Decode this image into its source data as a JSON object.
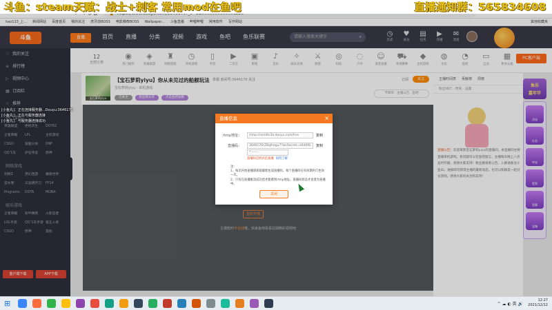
{
  "overlay": {
    "left_text": "斗鱼：steam天赋：战士+刺客 常用mod在鱼吧",
    "right_text": "直播通知群：565834608"
  },
  "browser": {
    "nav_glyphs": "← → ↻ ⌂",
    "url": "https://www.douyu.com/3646170?_c=1&0000000000001225",
    "bookmarks": [
      "hao123_上...",
      "新闻网站",
      "百度首页",
      "我的关注",
      "虎牙前BOSS",
      "电影推荐BOSS",
      "Wallpaper...",
      "斗鱼直播",
      "哔哩哔哩",
      "常用软件",
      "写作网站"
    ],
    "other_bookmarks": "其他收藏夹"
  },
  "topnav": {
    "logo": "斗鱼",
    "logo2": "直播",
    "menu": [
      "首页",
      "直播",
      "分类",
      "视频",
      "游戏",
      "鱼吧",
      "鱼乐联赛"
    ],
    "search_placeholder": "请输入搜索关键字",
    "icons": [
      {
        "icon": "history-icon",
        "glyph": "◷",
        "label": "历史"
      },
      {
        "icon": "follow-icon",
        "glyph": "♥",
        "label": "关注"
      },
      {
        "icon": "task-icon",
        "glyph": "▤",
        "label": "任务"
      },
      {
        "icon": "live-icon",
        "glyph": "▶",
        "label": "开播"
      },
      {
        "icon": "message-icon",
        "glyph": "✉",
        "label": "消息"
      }
    ]
  },
  "sidebar": {
    "items": [
      {
        "icon": "heart-icon",
        "glyph": "♡",
        "label": "我的关注"
      },
      {
        "icon": "list-icon",
        "glyph": "≡",
        "label": "排行榜"
      },
      {
        "icon": "video-icon",
        "glyph": "▷",
        "label": "视频中心"
      },
      {
        "icon": "grid-icon",
        "glyph": "▦",
        "label": "订阅栏"
      },
      {
        "icon": "star-icon",
        "glyph": "☆",
        "label": "推荐"
      }
    ],
    "section1_title": "热门游戏",
    "section1_items": [
      "英雄联盟",
      "绝地求生",
      "DOTA2",
      "王者荣耀",
      "LPL",
      "主机游戏",
      "CSGO",
      "穿越火线",
      "DNF",
      "QQ飞车",
      "炉石传说",
      "原神"
    ],
    "section2_title": "网络游戏",
    "section2_items": [
      "剑网3",
      "梦幻西游",
      "魔兽世界",
      "逆水寒",
      "天涯明月刀",
      "FF14",
      "Programs",
      "DOTA",
      "MOBA"
    ],
    "section3_title": "娱乐游戏",
    "section3_items": [
      "王者荣耀",
      "和平精英",
      "火影忍者",
      "LOL手游",
      "QQ飞车手游",
      "第五人格",
      "CSGO",
      "原神",
      "其他"
    ],
    "buttons": [
      "客户端下载",
      "APP下载"
    ]
  },
  "chatlog": [
    "[小鱼丸]：正在连接服务器...Douyu:3646170",
    "[小鱼丸]：正在与服务器连接",
    "[小鱼丸]：与服务器连接成功"
  ],
  "catbar": {
    "back_num": "12",
    "back_label": "全部分类",
    "categories": [
      {
        "icon": "hot-icon",
        "glyph": "◉",
        "label": "热门推荐"
      },
      {
        "icon": "lol-icon",
        "glyph": "◈",
        "label": "英雄联盟"
      },
      {
        "icon": "game-icon",
        "glyph": "♜",
        "label": "网络游戏"
      },
      {
        "icon": "clock-icon",
        "glyph": "◷",
        "label": "单机游戏"
      },
      {
        "icon": "mobile-icon",
        "glyph": "▯",
        "label": "手游"
      },
      {
        "icon": "play-icon",
        "glyph": "▶",
        "label": "二次元"
      },
      {
        "icon": "film-icon",
        "glyph": "▣",
        "label": "影视"
      },
      {
        "icon": "music-icon",
        "glyph": "♪",
        "label": "音乐"
      },
      {
        "icon": "yule-icon",
        "glyph": "✧",
        "label": "娱乐天地"
      },
      {
        "icon": "sword-icon",
        "glyph": "⚔",
        "label": "颜值"
      },
      {
        "icon": "eye-icon",
        "glyph": "◎",
        "label": "科技"
      },
      {
        "icon": "chat-icon",
        "glyph": "◌",
        "label": "户外"
      },
      {
        "icon": "people-icon",
        "glyph": "☺",
        "label": "语音直播"
      },
      {
        "icon": "car-icon",
        "glyph": "⛟",
        "label": "体育赛事"
      },
      {
        "icon": "gift-icon",
        "glyph": "◆",
        "label": "主机游戏"
      },
      {
        "icon": "bag-icon",
        "glyph": "◍",
        "label": "文化"
      },
      {
        "icon": "gauge-icon",
        "glyph": "◔",
        "label": "鱼吧"
      },
      {
        "icon": "chat2-icon",
        "glyph": "▭",
        "label": "互动"
      },
      {
        "icon": "chip-icon",
        "glyph": "▦",
        "label": "更多分类"
      }
    ],
    "pc_button": "PC客户端"
  },
  "room": {
    "title": "【宝石萝莉yiyu】你从未见过的船舰玩法",
    "meta": "举报  房间号:3646170  关注",
    "sub": "宝石萝莉yiyu  ·  单机游戏",
    "thumb_caption": "宝石萝莉yiyu",
    "tags": [
      {
        "label": "已关注",
        "color": "#999999"
      },
      {
        "label": "粉丝牌分享",
        "color": "#b083d8"
      },
      {
        "label": "点击鱼吧加群",
        "color": "#b083d8"
      }
    ],
    "follow_count": "订阅",
    "follow_button": "关注",
    "subscribe_text": "节目单  ·  主播公告  ·  鱼吧"
  },
  "player": {
    "offline_button": "重新开播",
    "offline_msg_pre": "主播暂时",
    "offline_msg_link": "不在线",
    "offline_msg_post": "哦，快来鱼吧看看往期精彩视频吧"
  },
  "rightpanel": {
    "tabs": [
      "主播时间表",
      "贡献榜",
      "周榜"
    ],
    "rank_header": "粉丝排行  ·  贵宾  ·  设置",
    "notice_label": "直播公告：",
    "notice_text": "欢迎来到宝石萝莉yiyu的直播间，本直播间主要直播单机游戏，有问题可以在鱼吧留言，主播每天晚上八点准时开播，谢谢大家支持！粉丝群请看公告，入群请备注斗鱼ID。进群即可获得主播的最新动态，也可以和群友一起讨论游戏。感谢大家的关注和支持！"
  },
  "floatbar": {
    "top": "鱼乐\n嘉年华",
    "items": [
      "活动",
      "礼包",
      "夺宝",
      "签到",
      "竞猜",
      "宝箱"
    ]
  },
  "modal": {
    "title": "直播信息",
    "rtmp_label": "rtmp地址：",
    "rtmp_value": "rtmp://sendtc3a.douyu.com/live",
    "key_label": "直播码：",
    "key_value": "3646170rZBqlhegu7?wsSecret=d4d0f8...",
    "select_value": "* ------",
    "copy_label": "复制",
    "hint": "直播码已经开启直播",
    "hint_link": "如何了解",
    "notes": "注：\n1、每次开始直播请获取最新生成直播码，每个直播码在有效期内只生效一次。\n2、只有在直播推流成功后才能看到rtmp地址，直播间状态才会变为直播中。",
    "close_button": "关闭"
  },
  "taskbar": {
    "tray_text": "^  ☁  ◐  英  🔊",
    "time": "12:27",
    "date": "2021/12/12"
  }
}
